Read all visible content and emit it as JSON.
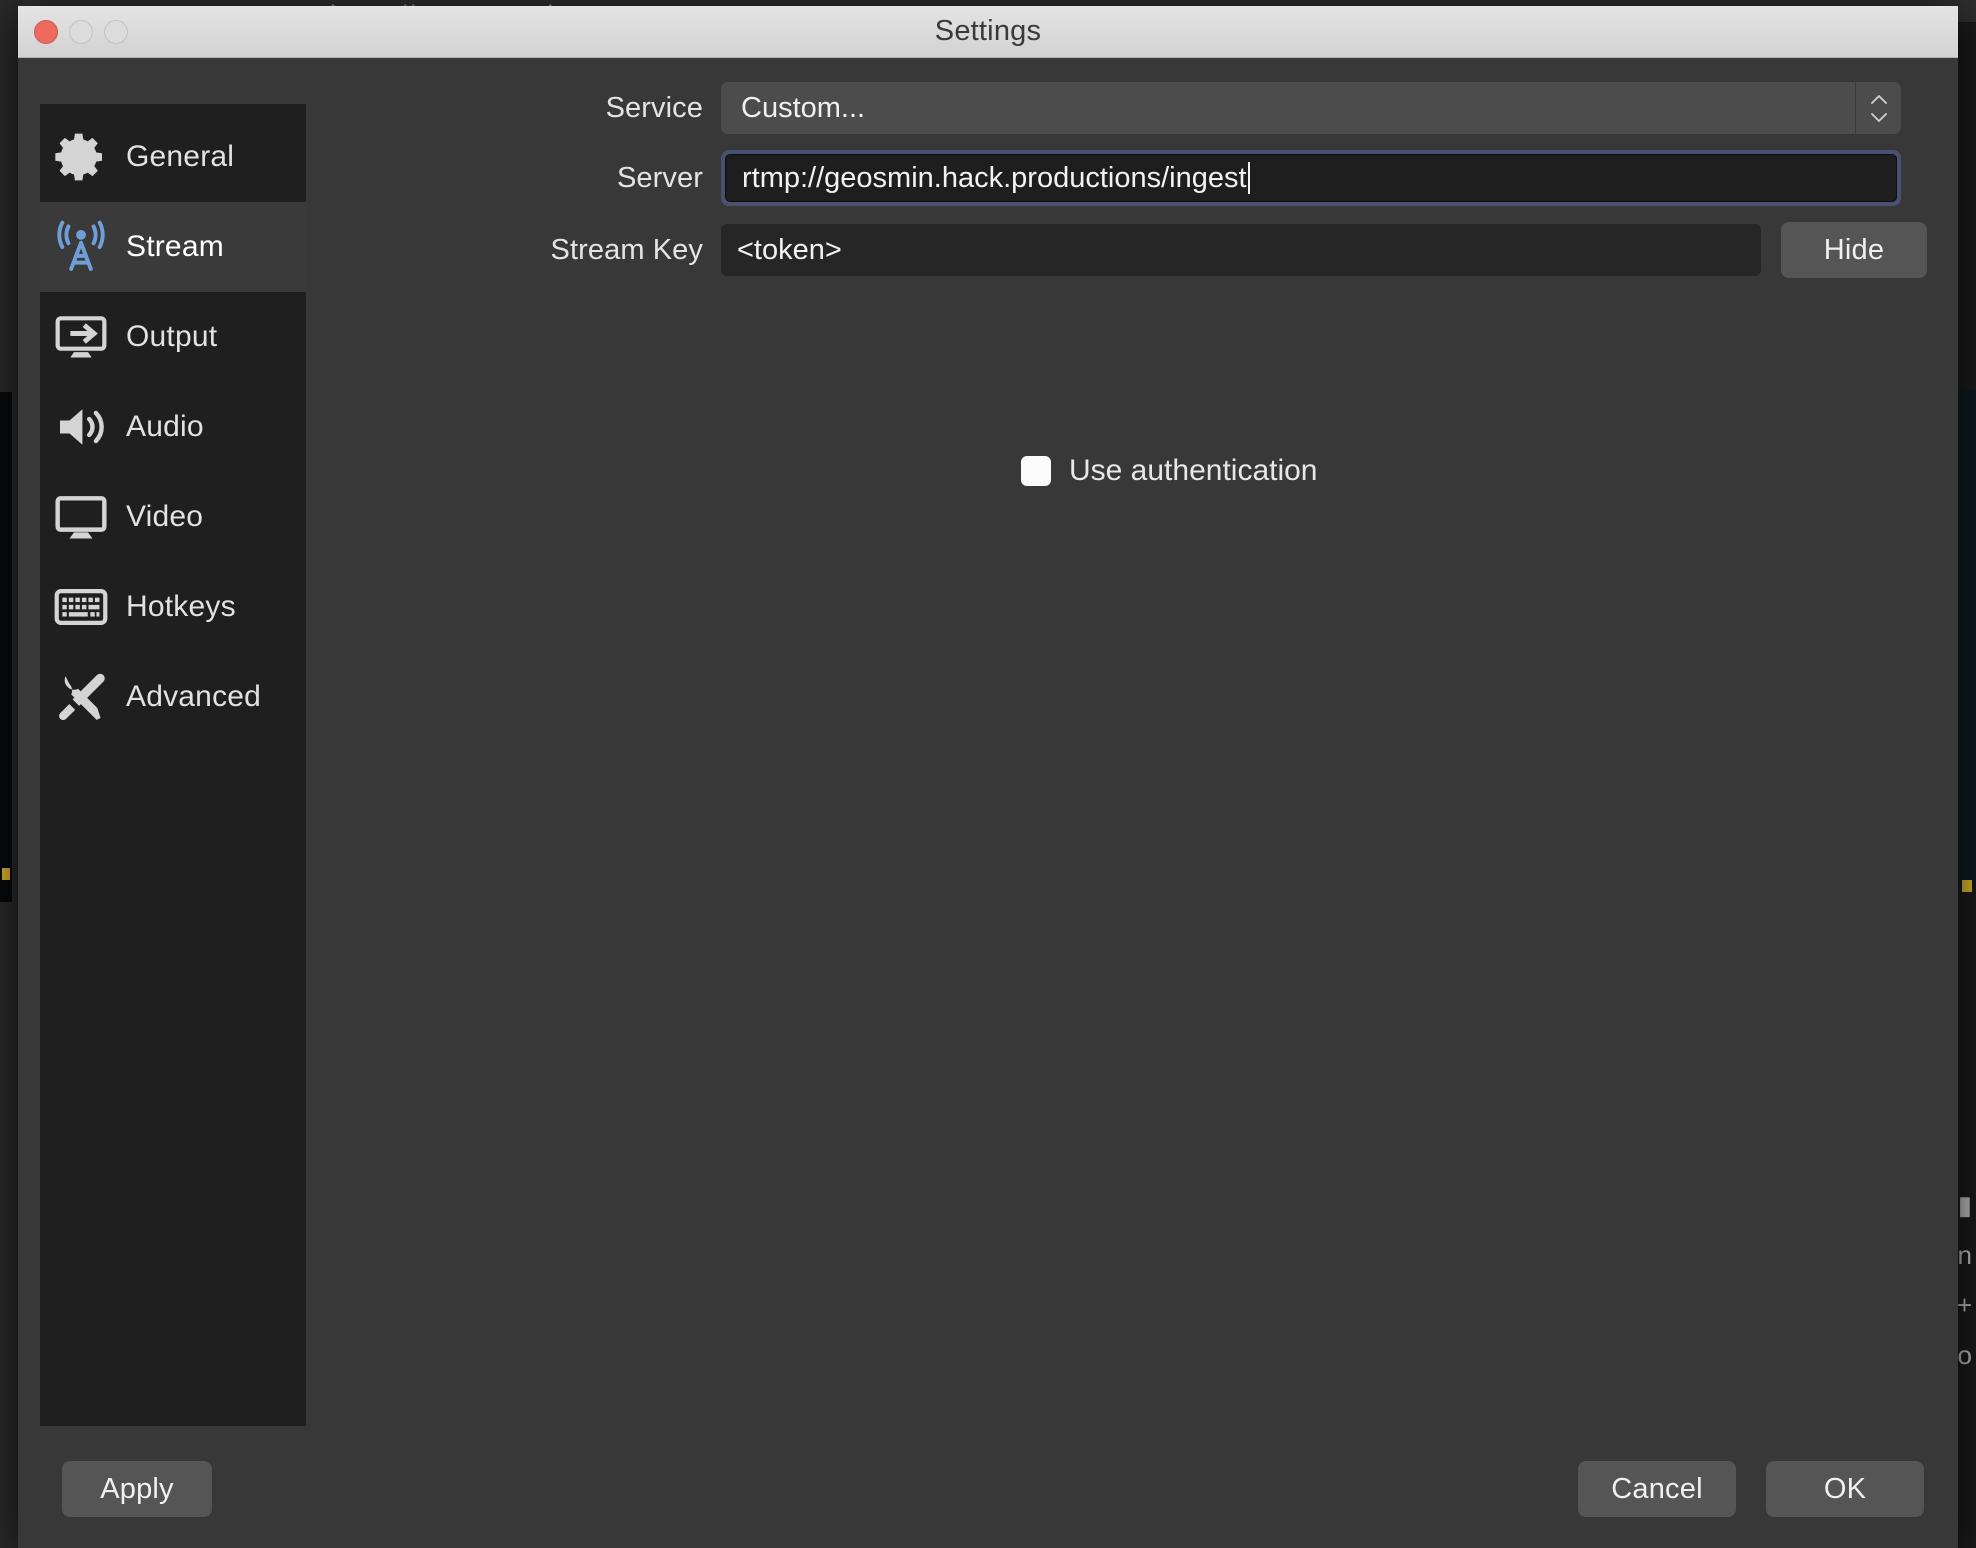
{
  "backdrop": {
    "browser_url": "https://meet.google.com",
    "bottom_left_text": "",
    "bottom_center_text": ""
  },
  "window": {
    "title": "Settings",
    "traffic_lights": [
      {
        "name": "close-button",
        "color": "#ed6a5e",
        "enabled": true
      },
      {
        "name": "minimize-button",
        "color": "#dcdcdc",
        "enabled": false
      },
      {
        "name": "zoom-button",
        "color": "#dcdcdc",
        "enabled": false
      }
    ]
  },
  "sidebar": {
    "items": [
      {
        "label": "General",
        "icon": "gear-icon",
        "selected": false
      },
      {
        "label": "Stream",
        "icon": "broadcast-icon",
        "selected": true
      },
      {
        "label": "Output",
        "icon": "output-icon",
        "selected": false
      },
      {
        "label": "Audio",
        "icon": "speaker-icon",
        "selected": false
      },
      {
        "label": "Video",
        "icon": "monitor-icon",
        "selected": false
      },
      {
        "label": "Hotkeys",
        "icon": "keyboard-icon",
        "selected": false
      },
      {
        "label": "Advanced",
        "icon": "tools-icon",
        "selected": false
      }
    ],
    "selected_accent": "#6f9fd8",
    "selected_bg": "#3a3a3a"
  },
  "stream_settings": {
    "service": {
      "label": "Service",
      "value": "Custom...",
      "stepper_icon": "chevron-updown-icon"
    },
    "server": {
      "label": "Server",
      "value": "rtmp://geosmin.hack.productions/ingest",
      "placeholder": "",
      "focused": true,
      "focus_ring_color": "#4a5170",
      "has_caret": true
    },
    "stream_key": {
      "label": "Stream Key",
      "value": "<token>",
      "placeholder": "",
      "hide_button_label": "Hide"
    },
    "use_authentication": {
      "label": "Use authentication",
      "checked": false
    }
  },
  "footer": {
    "apply_label": "Apply",
    "cancel_label": "Cancel",
    "ok_label": "OK"
  }
}
